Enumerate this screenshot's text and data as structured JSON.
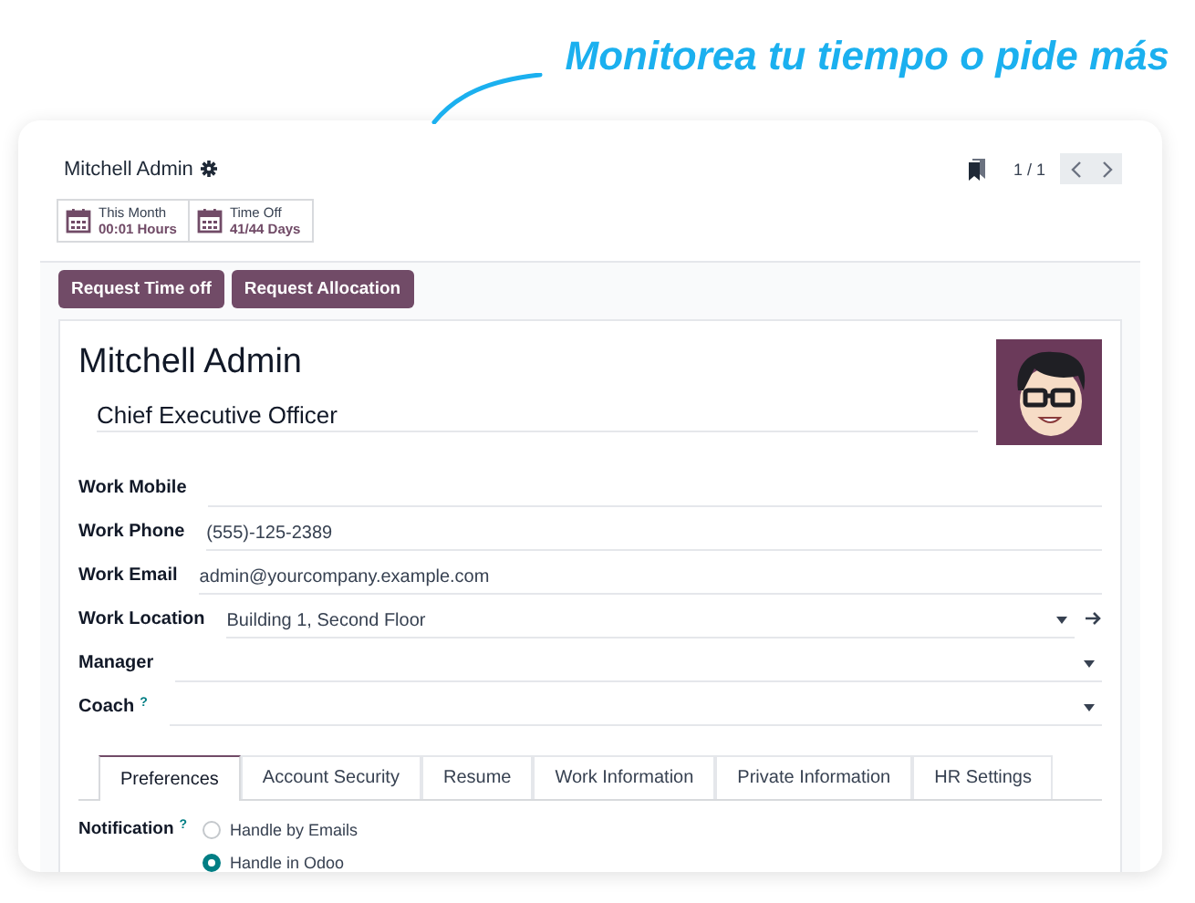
{
  "headline": "Monitorea tu tiempo o pide más",
  "record": {
    "name": "Mitchell Admin",
    "pager": "1 / 1",
    "stats": [
      {
        "label": "This Month",
        "value": "00:01 Hours"
      },
      {
        "label": "Time Off",
        "value": "41/44 Days"
      }
    ],
    "buttons": [
      "Request Time off",
      "Request Allocation"
    ],
    "employee_name": "Mitchell Admin",
    "job_title": "Chief Executive Officer",
    "fields": [
      {
        "label": "Work Mobile",
        "kind": "text",
        "external_link": false
      },
      {
        "label": "Work Phone",
        "value": "(555)-125-2389",
        "kind": "text",
        "external_link": false
      },
      {
        "label": "Work Email",
        "value": "admin@yourcompany.example.com",
        "kind": "text",
        "external_link": false
      },
      {
        "label": "Work Location",
        "value": "Building 1, Second Floor",
        "kind": "many2one",
        "external_link": true
      },
      {
        "label": "Manager",
        "kind": "many2one",
        "external_link": false
      },
      {
        "label": "Coach",
        "help_mark": "?",
        "kind": "many2one",
        "external_link": false
      }
    ],
    "tabs": [
      {
        "label": "Preferences",
        "selected": true
      },
      {
        "label": "Account Security",
        "selected": false
      },
      {
        "label": "Resume",
        "selected": false
      },
      {
        "label": "Work Information",
        "selected": false
      },
      {
        "label": "Private Information",
        "selected": false
      },
      {
        "label": "HR Settings",
        "selected": false
      }
    ],
    "notification": {
      "label": "Notification",
      "help_mark": "?",
      "options": [
        {
          "label": "Handle by Emails",
          "selected": false
        },
        {
          "label": "Handle in Odoo",
          "selected": true
        }
      ]
    }
  }
}
